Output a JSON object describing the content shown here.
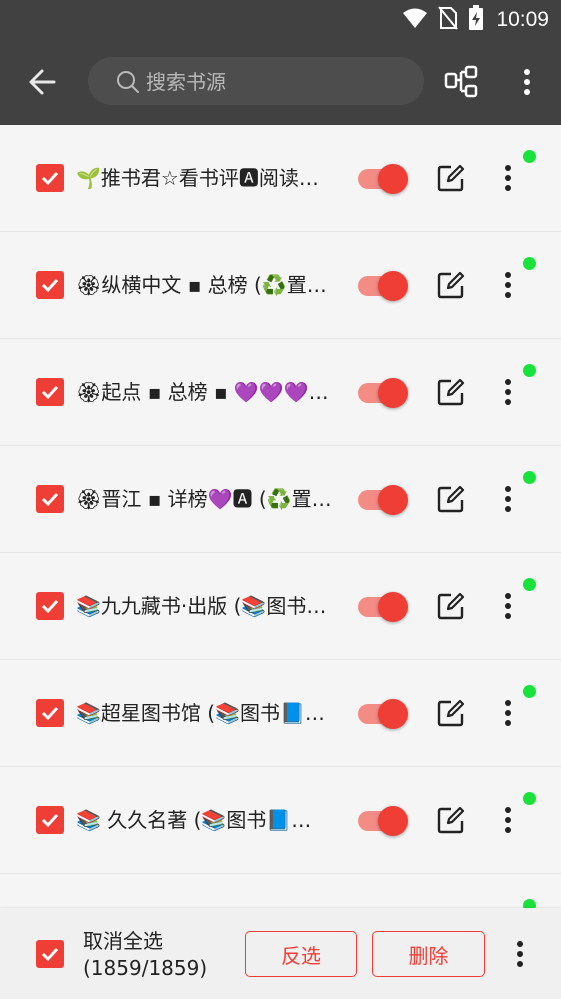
{
  "status_bar": {
    "time": "10:09",
    "icons": [
      "wifi-icon",
      "no-sim-icon",
      "battery-charging-icon"
    ]
  },
  "toolbar": {
    "back_icon": "arrow-left-icon",
    "search_placeholder": "搜索书源",
    "search_value": "",
    "group_icon": "group-icon",
    "more_icon": "more-vertical-icon"
  },
  "sources": [
    {
      "name": "🌱推书君☆看书评🅰阅读…",
      "checked": true,
      "enabled": true
    },
    {
      "name": "🏵纵横中文 ▪ 总榜 (♻️置…",
      "checked": true,
      "enabled": true
    },
    {
      "name": "🏵起点 ▪ 总榜 ▪ 💜💜💜…",
      "checked": true,
      "enabled": true
    },
    {
      "name": "🏵晋江 ▪ 详榜💜🅰 (♻️置…",
      "checked": true,
      "enabled": true
    },
    {
      "name": "📚九九藏书·出版 (📚图书…",
      "checked": true,
      "enabled": true
    },
    {
      "name": "📚超星图书馆 (📚图书📘…",
      "checked": true,
      "enabled": true
    },
    {
      "name": "📚 久久名著 (📚图书📘…",
      "checked": true,
      "enabled": true
    },
    {
      "name": "",
      "checked": true,
      "enabled": true
    }
  ],
  "bottom_bar": {
    "select_label": "取消全选",
    "count": "(1859/1859)",
    "invert_label": "反选",
    "delete_label": "删除"
  },
  "colors": {
    "accent": "#ef3e36",
    "toolbar": "#414141",
    "status_dot": "#19e33b"
  }
}
